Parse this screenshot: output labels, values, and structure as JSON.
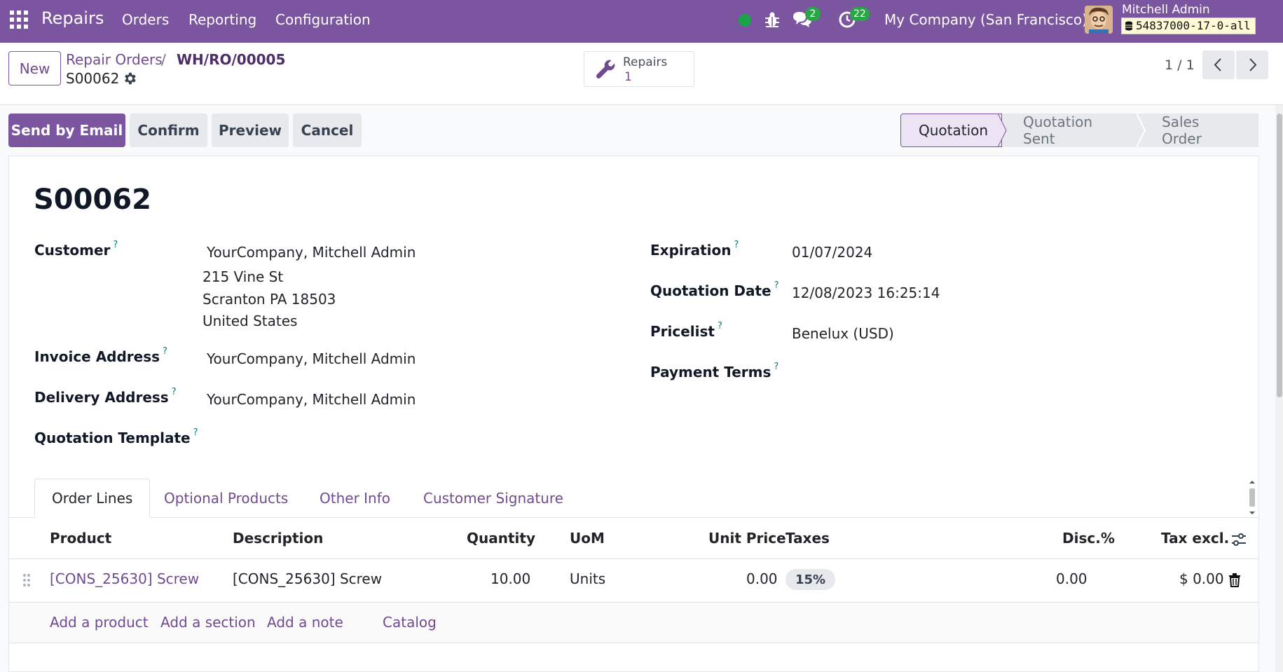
{
  "navbar": {
    "app_name": "Repairs",
    "menu": [
      "Orders",
      "Reporting",
      "Configuration"
    ],
    "messages_count": "2",
    "activities_count": "22",
    "company": "My Company (San Francisco)",
    "user_name": "Mitchell Admin",
    "database": "54837000-17-0-all"
  },
  "control": {
    "new_label": "New",
    "breadcrumb_parent_1": "Repair Orders",
    "breadcrumb_sep": "/",
    "breadcrumb_parent_2": "WH/RO/00005",
    "record_name": "S00062",
    "smart_button": {
      "label": "Repairs",
      "count": "1"
    },
    "pager": "1 / 1"
  },
  "actions": {
    "send_email": "Send by Email",
    "confirm": "Confirm",
    "preview": "Preview",
    "cancel": "Cancel"
  },
  "statusbar": [
    "Quotation",
    "Quotation Sent",
    "Sales Order"
  ],
  "form": {
    "title": "S00062",
    "customer_label": "Customer",
    "customer_name": "YourCompany, Mitchell Admin",
    "customer_address": [
      "215 Vine St",
      "Scranton PA 18503",
      "United States"
    ],
    "invoice_label": "Invoice Address",
    "invoice_value": "YourCompany, Mitchell Admin",
    "delivery_label": "Delivery Address",
    "delivery_value": "YourCompany, Mitchell Admin",
    "template_label": "Quotation Template",
    "expiration_label": "Expiration",
    "expiration_value": "01/07/2024",
    "quotation_date_label": "Quotation Date",
    "quotation_date_value": "12/08/2023 16:25:14",
    "pricelist_label": "Pricelist",
    "pricelist_value": "Benelux (USD)",
    "payment_terms_label": "Payment Terms",
    "help_mark": "?"
  },
  "tabs": [
    "Order Lines",
    "Optional Products",
    "Other Info",
    "Customer Signature"
  ],
  "table": {
    "headers": [
      "Product",
      "Description",
      "Quantity",
      "UoM",
      "Unit Price",
      "Taxes",
      "Disc.%",
      "Tax excl."
    ],
    "rows": [
      {
        "product": "[CONS_25630] Screw",
        "description": "[CONS_25630] Screw",
        "quantity": "10.00",
        "uom": "Units",
        "unit_price": "0.00",
        "taxes": "15%",
        "discount": "0.00",
        "subtotal": "$ 0.00"
      }
    ],
    "add_links": [
      "Add a product",
      "Add a section",
      "Add a note",
      "Catalog"
    ]
  },
  "colors": {
    "brand": "#7c55a0",
    "link": "#714b8f",
    "badge": "#28a745"
  }
}
